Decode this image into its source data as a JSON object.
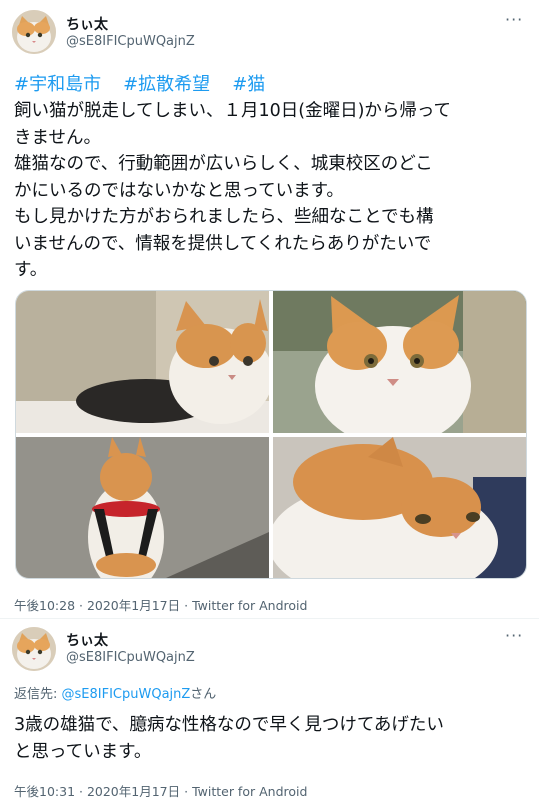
{
  "tweet1": {
    "display_name": "ちぃ太",
    "handle": "@sE8IFICpuWQajnZ",
    "more_icon": "more-dots-icon",
    "hashtags": [
      "#宇和島市",
      "#拡散希望",
      "#猫"
    ],
    "lines": [
      "飼い猫が脱走してしまい、１月10日(金曜日)から帰って",
      "きません。",
      "雄猫なので、行動範囲が広いらしく、城東校区のどこ",
      "かにいるのではないかなと思っています。",
      "もし見かけた方がおられましたら、些細なことでも構",
      "いませんので、情報を提供してくれたらありがたいで",
      "す。"
    ],
    "time": "午後10:28 · 2020年1月17日",
    "source": "Twitter for Android"
  },
  "tweet2": {
    "display_name": "ちぃ太",
    "handle": "@sE8IFICpuWQajnZ",
    "more_icon": "more-dots-icon",
    "reply_label": "返信先: ",
    "reply_mention": "@sE8IFICpuWQajnZ",
    "reply_suffix": "さん",
    "lines": [
      "3歳の雄猫で、臆病な性格なので早く見つけてあげたい",
      "と思っています。"
    ],
    "time": "午後10:31 · 2020年1月17日",
    "source": "Twitter for Android"
  }
}
